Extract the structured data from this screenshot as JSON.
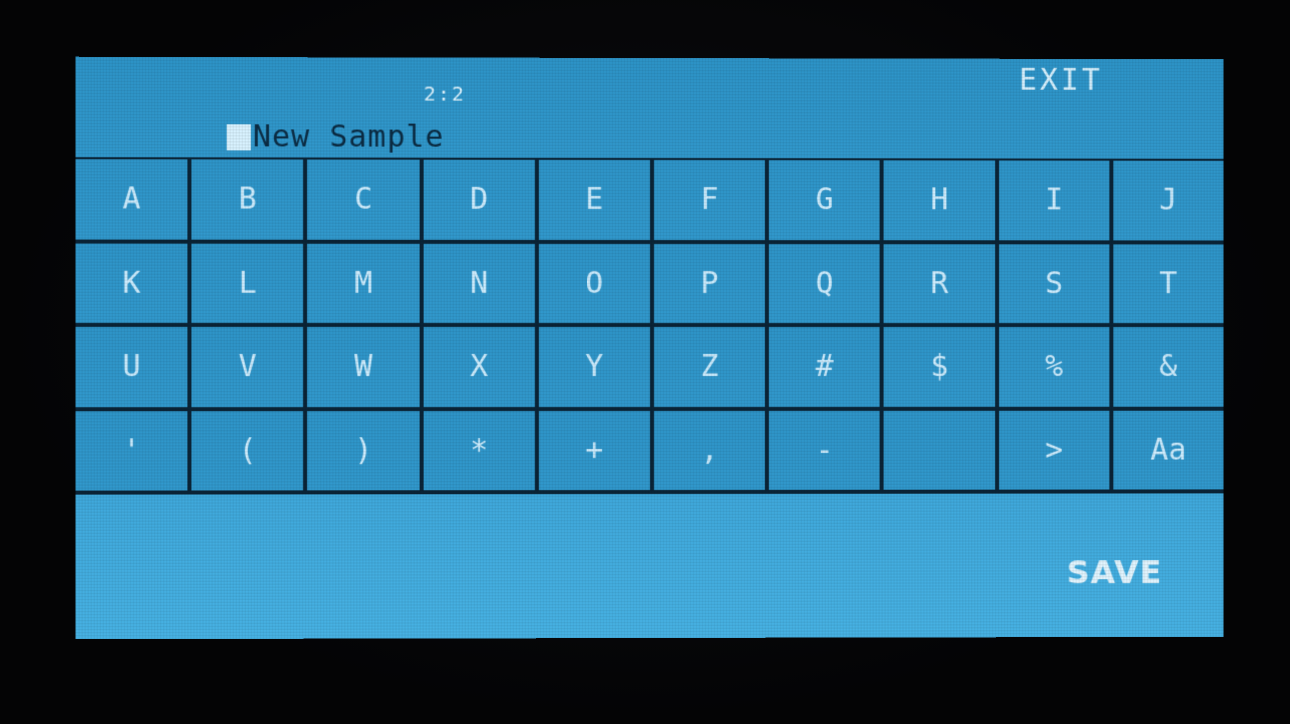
{
  "header": {
    "position": "2:2",
    "exit_label": "EXIT",
    "name_value": "New Sample"
  },
  "keyboard": {
    "rows": [
      [
        "A",
        "B",
        "C",
        "D",
        "E",
        "F",
        "G",
        "H",
        "I",
        "J"
      ],
      [
        "K",
        "L",
        "M",
        "N",
        "O",
        "P",
        "Q",
        "R",
        "S",
        "T"
      ],
      [
        "U",
        "V",
        "W",
        "X",
        "Y",
        "Z",
        "#",
        "$",
        "%",
        "&"
      ],
      [
        "'",
        "(",
        ")",
        "*",
        "+",
        ",",
        "-",
        " ",
        ">",
        "Aa"
      ]
    ]
  },
  "footer": {
    "save_label": "SAVE"
  },
  "colors": {
    "screen": "#3aa3d7",
    "grid_lines": "#0a2437",
    "key_text": "#cfeeff"
  }
}
